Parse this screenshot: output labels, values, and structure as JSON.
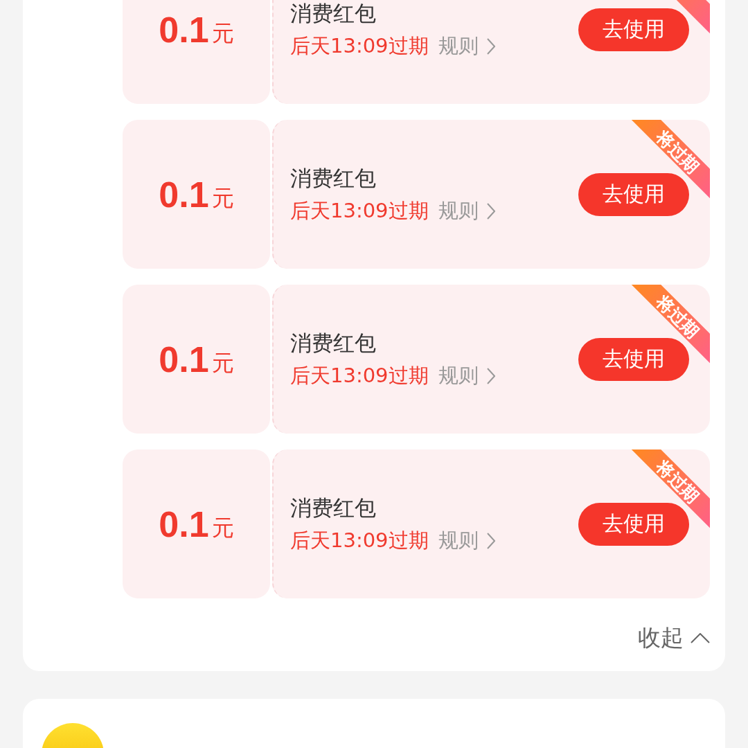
{
  "coupons": [
    {
      "amount": "0.1",
      "unit": "元",
      "title": "消费红包",
      "expiry": "后天13:09过期",
      "rules": "规则",
      "button": "去使用",
      "expiring": true
    },
    {
      "amount": "0.1",
      "unit": "元",
      "title": "消费红包",
      "expiry": "后天13:09过期",
      "rules": "规则",
      "button": "去使用",
      "expiring": true,
      "ribbon": "将过期"
    },
    {
      "amount": "0.1",
      "unit": "元",
      "title": "消费红包",
      "expiry": "后天13:09过期",
      "rules": "规则",
      "button": "去使用",
      "expiring": true,
      "ribbon": "将过期"
    },
    {
      "amount": "0.1",
      "unit": "元",
      "title": "消费红包",
      "expiry": "后天13:09过期",
      "rules": "规则",
      "button": "去使用",
      "expiring": true,
      "ribbon": "将过期"
    }
  ],
  "collapse": {
    "label": "收起"
  }
}
